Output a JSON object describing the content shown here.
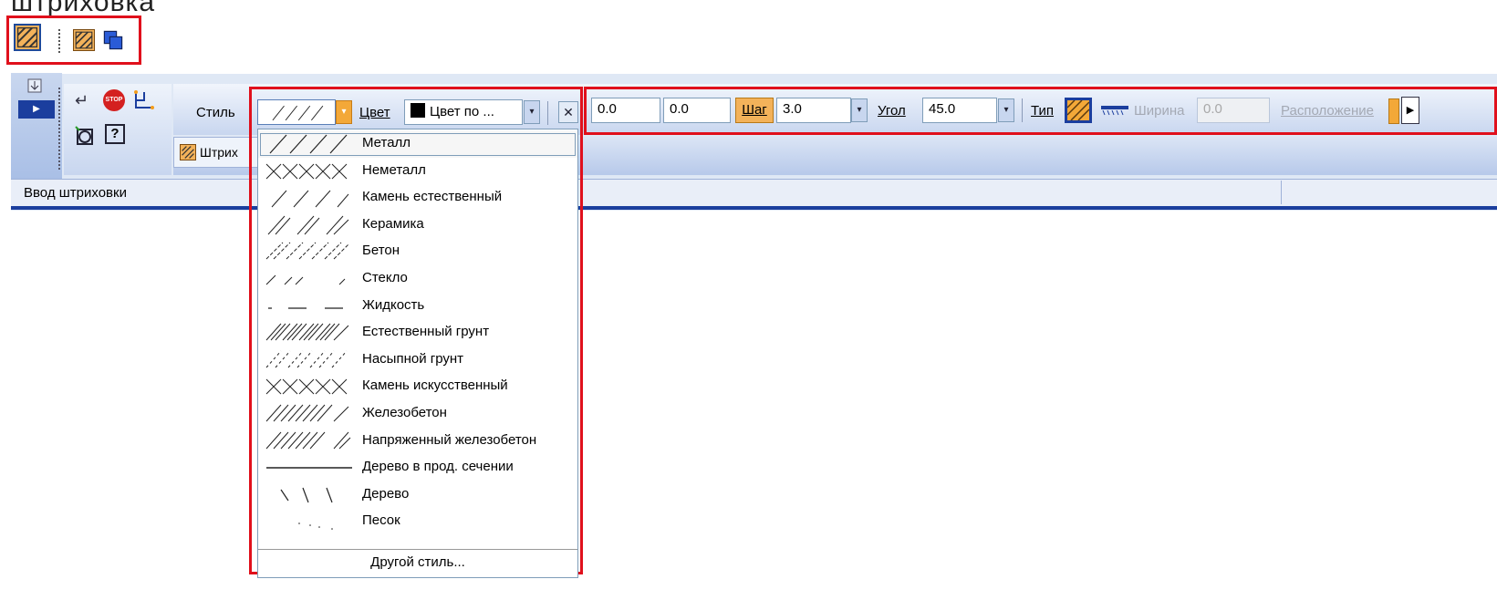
{
  "title_text": "штриховка",
  "status_text": "Ввод штриховки",
  "toolbar": {
    "style_label": "Стиль",
    "color_label": "Цвет",
    "color_value": "Цвет по ...",
    "x_value": "0.0",
    "y_value": "0.0",
    "step_label": "Шаг",
    "step_value": "3.0",
    "angle_label": "Угол",
    "angle_value": "45.0",
    "type_label": "Тип",
    "width_label": "Ширина",
    "width_value": "0.0",
    "placement_label": "Расположение",
    "hatch_tab_label": "Штрих"
  },
  "dropdown": {
    "items": [
      {
        "label": "Металл",
        "pattern": "metal"
      },
      {
        "label": "Неметалл",
        "pattern": "nonmetal"
      },
      {
        "label": "Камень естественный",
        "pattern": "stone"
      },
      {
        "label": "Керамика",
        "pattern": "ceramic"
      },
      {
        "label": "Бетон",
        "pattern": "concrete"
      },
      {
        "label": "Стекло",
        "pattern": "glass"
      },
      {
        "label": "Жидкость",
        "pattern": "liquid"
      },
      {
        "label": "Естественный грунт",
        "pattern": "soil"
      },
      {
        "label": "Насыпной грунт",
        "pattern": "fill"
      },
      {
        "label": "Камень искусственный",
        "pattern": "artstone"
      },
      {
        "label": "Железобетон",
        "pattern": "rc"
      },
      {
        "label": "Напряженный железобетон",
        "pattern": "prc"
      },
      {
        "label": "Дерево в прод. сечении",
        "pattern": "woodlong"
      },
      {
        "label": "Дерево",
        "pattern": "wood"
      },
      {
        "label": "Песок",
        "pattern": "sand"
      }
    ],
    "other_label": "Другой стиль..."
  },
  "colors": {
    "accent_red": "#e0101c",
    "panel": "#dfe8f5",
    "hatch_orange": "#f3b25a",
    "blue": "#1b3e9e"
  }
}
